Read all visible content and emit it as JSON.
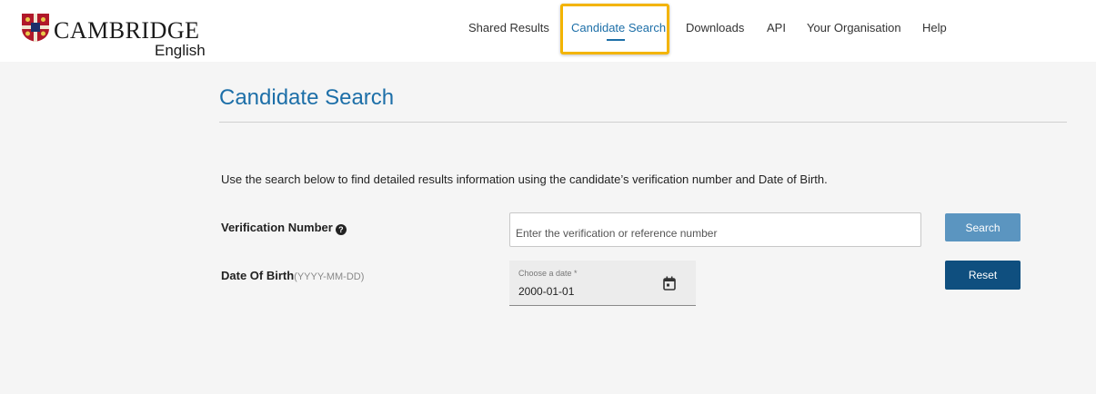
{
  "brand": {
    "word": "CAMBRIDGE",
    "sub": "English"
  },
  "nav": {
    "items": [
      {
        "label": "Shared Results",
        "active": false
      },
      {
        "label": "Candidate Search",
        "active": true
      },
      {
        "label": "Downloads",
        "active": false
      },
      {
        "label": "API",
        "active": false
      },
      {
        "label": "Your Organisation",
        "active": false
      },
      {
        "label": "Help",
        "active": false
      }
    ]
  },
  "page": {
    "title": "Candidate Search",
    "intro": "Use the search below to find detailed results information using the candidate’s verification number and Date of Birth."
  },
  "form": {
    "verification": {
      "label": "Verification Number",
      "help_icon": "question-circle-icon",
      "placeholder": "Enter the verification or reference number",
      "value": ""
    },
    "dob": {
      "label": "Date Of Birth",
      "hint": "(YYYY-MM-DD)",
      "float_label": "Choose a date *",
      "value": "2000-01-01",
      "icon": "calendar-icon"
    },
    "search_label": "Search",
    "reset_label": "Reset"
  },
  "colors": {
    "accent": "#1d6fa8",
    "highlight": "#f3b400",
    "search_button": "#5b95c0",
    "reset_button": "#0f4f7f"
  }
}
